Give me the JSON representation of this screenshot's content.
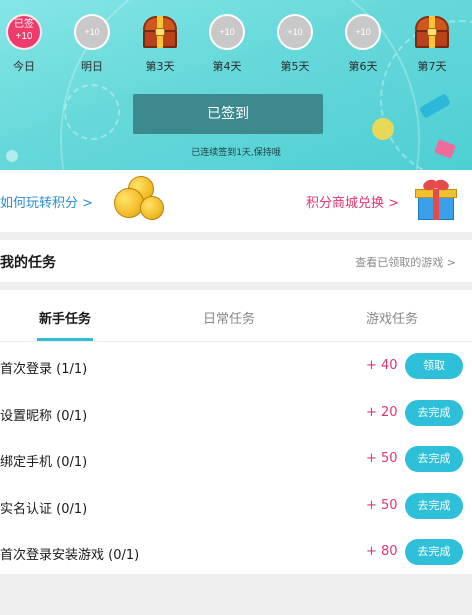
{
  "checkin": {
    "days": [
      {
        "label": "今日",
        "badge_top": "已签",
        "badge_bottom": "+10",
        "state": "signed"
      },
      {
        "label": "明日",
        "badge": "+10",
        "state": "pending"
      },
      {
        "label": "第3天",
        "icon": "treasure-chest-icon",
        "state": "chest"
      },
      {
        "label": "第4天",
        "badge": "+10",
        "state": "pending"
      },
      {
        "label": "第5天",
        "badge": "+10",
        "state": "pending"
      },
      {
        "label": "第6天",
        "badge": "+10",
        "state": "pending"
      },
      {
        "label": "第7天",
        "icon": "treasure-chest-icon",
        "state": "chest"
      }
    ],
    "signed_button": "已签到",
    "streak_text": "已连续签到1天,保持哦"
  },
  "links": {
    "how_to_earn": "如何玩转积分 >",
    "mall": "积分商城兑换 >",
    "left_icon": "gold-coins-icon",
    "right_icon": "gift-box-icon"
  },
  "my_tasks": {
    "title": "我的任务",
    "claimed_games": "查看已领取的游戏 >"
  },
  "tabs": [
    "新手任务",
    "日常任务",
    "游戏任务"
  ],
  "active_tab": 0,
  "tasks": [
    {
      "name": "首次登录 (1/1)",
      "points": "+ 40",
      "action": "领取"
    },
    {
      "name": "设置昵称 (0/1)",
      "points": "+ 20",
      "action": "去完成"
    },
    {
      "name": "绑定手机 (0/1)",
      "points": "+ 50",
      "action": "去完成"
    },
    {
      "name": "实名认证 (0/1)",
      "points": "+ 50",
      "action": "去完成"
    },
    {
      "name": "首次登录安装游戏 (0/1)",
      "points": "+ 80",
      "action": "去完成"
    }
  ],
  "colors": {
    "accent": "#2ec0d8",
    "points": "#e4356e",
    "signed_badge": "#ef3a6c",
    "signed_button": "#3c8a8e"
  }
}
